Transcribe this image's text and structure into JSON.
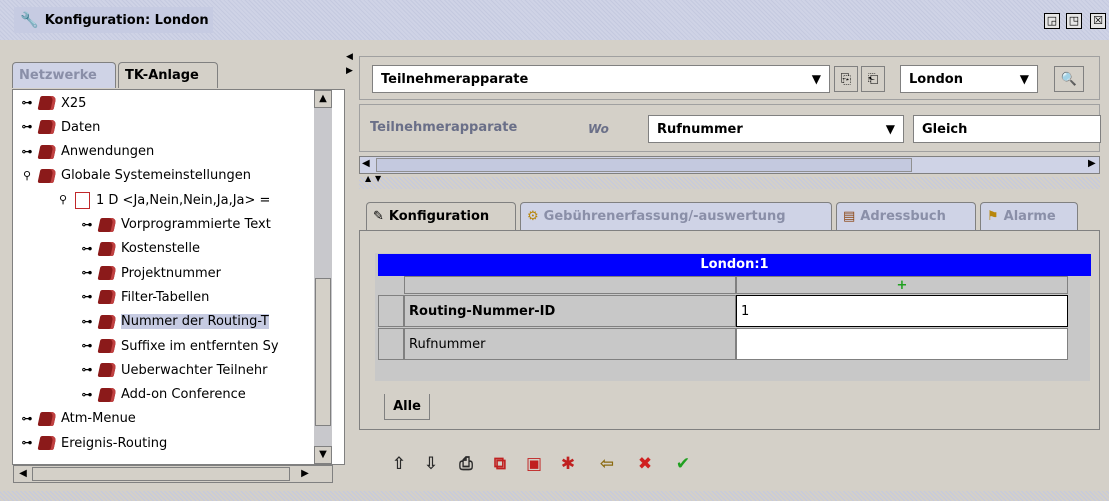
{
  "window": {
    "title": "Konfiguration: London",
    "btn_restore": "◲",
    "btn_max": "◳",
    "btn_close": "☒"
  },
  "left_tabs": [
    {
      "label": "Netzwerke",
      "active": false
    },
    {
      "label": "TK-Anlage",
      "active": true
    }
  ],
  "tree": {
    "items": [
      {
        "label": "X25",
        "handle": "⊶",
        "type": "folder",
        "level": 0
      },
      {
        "label": "Daten",
        "handle": "⊶",
        "type": "folder",
        "level": 0
      },
      {
        "label": "Anwendungen",
        "handle": "⊶",
        "type": "folder",
        "level": 0
      },
      {
        "label": "Globale Systemeinstellungen",
        "handle": "⚲",
        "type": "folder",
        "level": 0
      },
      {
        "label": "1 D <Ja,Nein,Nein,Ja,Ja> =",
        "handle": "⚲",
        "type": "doc",
        "level": 1
      },
      {
        "label": "Vorprogrammierte Text",
        "handle": "⊶",
        "type": "folder",
        "level": 2
      },
      {
        "label": "Kostenstelle",
        "handle": "⊶",
        "type": "folder",
        "level": 2
      },
      {
        "label": "Projektnummer",
        "handle": "⊶",
        "type": "folder",
        "level": 2
      },
      {
        "label": "Filter-Tabellen",
        "handle": "⊶",
        "type": "folder",
        "level": 2
      },
      {
        "label": "Nummer der Routing-T",
        "handle": "⊶",
        "type": "folder",
        "level": 2
      },
      {
        "label": "Suffixe im entfernten Sy",
        "handle": "⊶",
        "type": "folder",
        "level": 2
      },
      {
        "label": "Ueberwachter Teilnehr",
        "handle": "⊶",
        "type": "folder",
        "level": 2
      },
      {
        "label": "Add-on Conference",
        "handle": "⊶",
        "type": "folder",
        "level": 2
      },
      {
        "label": "Atm-Menue",
        "handle": "⊶",
        "type": "folder",
        "level": 0
      },
      {
        "label": "Ereignis-Routing",
        "handle": "⊶",
        "type": "folder",
        "level": 0
      }
    ]
  },
  "toolbar": {
    "object_combo": "Teilnehmerapparate",
    "site_combo": "London",
    "copy_icon": "⎘",
    "paste_icon": "⎗",
    "search_icon": "🔍"
  },
  "filter": {
    "label": "Teilnehmerapparate",
    "wo": "Wo",
    "field_combo": "Rufnummer",
    "op_combo": "Gleich"
  },
  "tabs": [
    {
      "label": "Konfiguration",
      "icon": "✎",
      "active": true
    },
    {
      "label": "Gebührenerfassung/-auswertung",
      "icon": "⚙",
      "active": false
    },
    {
      "label": "Adressbuch",
      "icon": "▤",
      "active": false
    },
    {
      "label": "Alarme",
      "icon": "⚑",
      "active": false
    }
  ],
  "grid": {
    "title": "London:1",
    "add_marker": "+",
    "rows": [
      {
        "field": "Routing-Nummer-ID",
        "value": "1",
        "bold": true
      },
      {
        "field": "Rufnummer",
        "value": "",
        "bold": false
      }
    ],
    "sub_tab": "Alle"
  },
  "footer_icons": [
    {
      "name": "move-up-icon",
      "glyph": "⇧",
      "color": "#2a2a2a"
    },
    {
      "name": "move-down-icon",
      "glyph": "⇩",
      "color": "#2a2a2a"
    },
    {
      "name": "print-icon",
      "glyph": "⎙",
      "color": "#2a2a2a"
    },
    {
      "name": "copy-record-icon",
      "glyph": "⧉",
      "color": "#c02020"
    },
    {
      "name": "new-record-icon",
      "glyph": "▣",
      "color": "#c02020"
    },
    {
      "name": "new-item-icon",
      "glyph": "✱",
      "color": "#c02020"
    },
    {
      "name": "signpost-icon",
      "glyph": "⇦",
      "color": "#8b6a10"
    },
    {
      "name": "delete-icon",
      "glyph": "✖",
      "color": "#d02020"
    },
    {
      "name": "apply-icon",
      "glyph": "✔",
      "color": "#20a020"
    }
  ]
}
